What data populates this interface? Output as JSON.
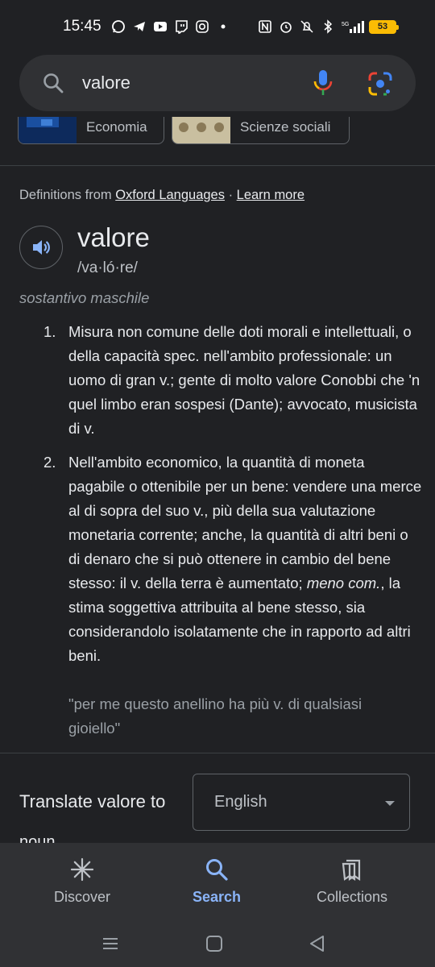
{
  "status_bar": {
    "time": "15:45",
    "battery": "53",
    "left_icons": [
      "whatsapp-icon",
      "telegram-icon",
      "youtube-icon",
      "twitch-icon",
      "instagram-icon",
      "dot-icon"
    ],
    "right_icons": [
      "nfc-icon",
      "alarm-icon",
      "mute-icon",
      "bluetooth-icon",
      "5g-signal-icon"
    ]
  },
  "search": {
    "query": "valore"
  },
  "chips": [
    {
      "label": "Economia"
    },
    {
      "label": "Scienze sociali"
    }
  ],
  "dictionary": {
    "source_prefix": "Definitions from ",
    "source_link": "Oxford Languages",
    "separator": " · ",
    "learn_more": "Learn more",
    "word": "valore",
    "phonetic": "/va·ló·re/",
    "part_of_speech": "sostantivo maschile",
    "senses": [
      {
        "number": "1.",
        "text": "Misura non comune delle doti morali e intellettuali, o della capacità spec. nell'ambito professionale: un uomo di gran v.; gente di molto valore Conobbi che 'n quel limbo eran sospesi (Dante); avvocato, musicista di v."
      },
      {
        "number": "2.",
        "text_part1": "Nell'ambito economico, la quantità di moneta pagabile o ottenibile per un bene: vendere una merce al di sopra del suo v., più della sua valutazione monetaria corrente; anche, la quantità di altri beni o di denaro che si può ottenere in cambio del bene stesso: il v. della terra è aumentato; ",
        "text_italic": "meno com.",
        "text_part2": ", la stima soggettiva attribuita al bene stesso, sia considerandolo isolatamente che in rapporto ad altri beni.",
        "example": "\"per me questo anellino ha più v. di qualsiasi gioiello\""
      }
    ]
  },
  "translate": {
    "label": "Translate valore to",
    "language": "English"
  },
  "next_section_peek": "noun",
  "bottom_nav": [
    {
      "label": "Discover",
      "active": false
    },
    {
      "label": "Search",
      "active": true
    },
    {
      "label": "Collections",
      "active": false
    }
  ],
  "colors": {
    "background": "#202124",
    "surface": "#303134",
    "accent": "#8ab4f8",
    "text": "#e8eaed",
    "muted": "#9aa0a6"
  }
}
